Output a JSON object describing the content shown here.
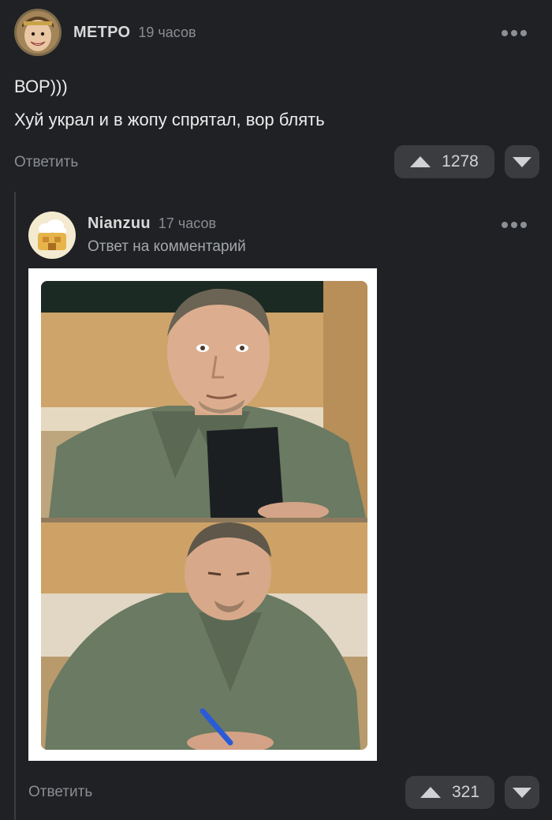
{
  "comment": {
    "author": "МЕТРО",
    "time": "19 часов",
    "text_line1": "ВОР)))",
    "text_line2": "Хуй украл и в жопу спрятал, вор блять",
    "reply_label": "Ответить",
    "votes": "1278"
  },
  "reply": {
    "author": "Nianzuu",
    "time": "17 часов",
    "reply_to": "Ответ на комментарий",
    "reply_label": "Ответить",
    "votes": "321"
  },
  "colors": {
    "background": "#1f2124",
    "button_bg": "#3a3c40",
    "muted_text": "#8a8d92"
  },
  "icons": [
    "more-options-icon",
    "upvote-icon",
    "downvote-icon"
  ]
}
